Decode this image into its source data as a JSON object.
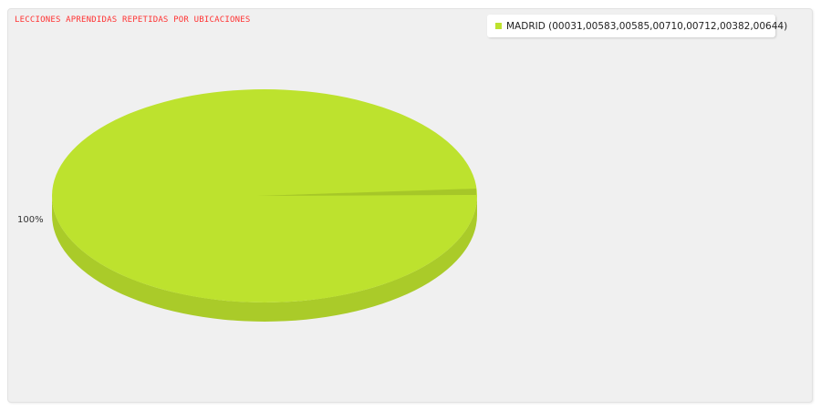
{
  "chart_data": {
    "type": "pie",
    "title": "LECCIONES APRENDIDAS REPETIDAS POR UBICACIONES",
    "series": [
      {
        "name": "MADRID (00031,00583,00585,00710,00712,00382,00644)",
        "value": 100,
        "label": "100%",
        "color": "#bde22e"
      }
    ],
    "legend_position": "top-right",
    "style": "3d"
  }
}
